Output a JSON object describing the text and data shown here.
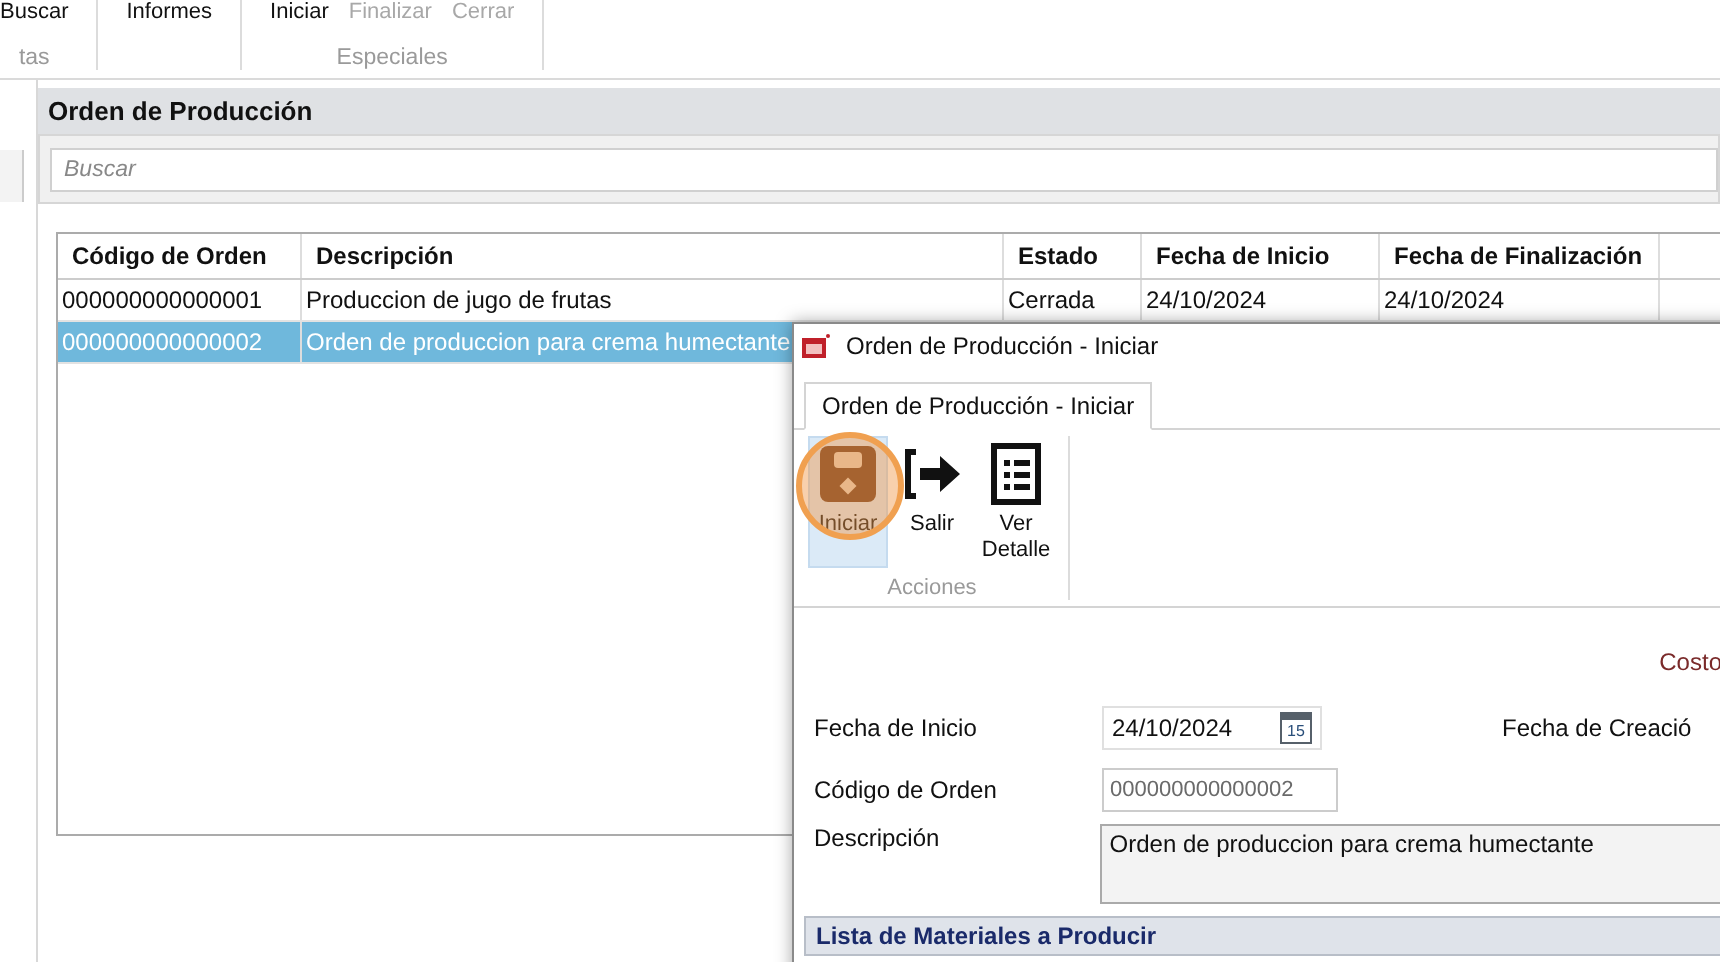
{
  "ribbon": {
    "groups": [
      {
        "label": "tas",
        "buttons": [
          {
            "label": "Buscar",
            "disabled": false
          }
        ]
      },
      {
        "buttons": [
          {
            "label": "Informes",
            "disabled": false
          }
        ]
      },
      {
        "label": "Especiales",
        "buttons": [
          {
            "label": "Iniciar",
            "disabled": false
          },
          {
            "label": "Finalizar",
            "disabled": true
          },
          {
            "label": "Cerrar",
            "disabled": true
          }
        ]
      }
    ]
  },
  "panel": {
    "title": "Orden de Producción",
    "search": {
      "placeholder": "Buscar"
    },
    "table": {
      "columns": [
        "Código de Orden",
        "Descripción",
        "Estado",
        "Fecha de Inicio",
        "Fecha de Finalización"
      ],
      "rows": [
        {
          "cells": [
            "000000000000001",
            "Produccion de jugo de frutas",
            "Cerrada",
            "24/10/2024",
            "24/10/2024"
          ],
          "selected": false
        },
        {
          "cells": [
            "000000000000002",
            "Orden de produccion para crema humectante",
            "",
            "",
            ""
          ],
          "selected": true
        }
      ]
    }
  },
  "dialog": {
    "title": "Orden de Producción - Iniciar",
    "tabs": [
      {
        "label": "Orden de Producción - Iniciar",
        "selected": true
      }
    ],
    "actions": {
      "label": "Acciones",
      "buttons": [
        {
          "label": "Iniciar",
          "kind": "save",
          "highlighted": true
        },
        {
          "label": "Salir",
          "kind": "exit",
          "highlighted": false
        },
        {
          "label": "Ver Detalle",
          "kind": "list",
          "highlighted": false
        }
      ]
    },
    "form": {
      "cost_label": "Costo",
      "start_date": {
        "label": "Fecha de Inicio",
        "value": "24/10/2024",
        "calendar_day": "15"
      },
      "created_label": "Fecha de Creació",
      "code": {
        "label": "Código de Orden",
        "value": "000000000000002",
        "disabled": true
      },
      "description": {
        "label": "Descripción",
        "value": "Orden de produccion para crema humectante"
      },
      "section_header": "Lista de Materiales a Producir"
    }
  }
}
